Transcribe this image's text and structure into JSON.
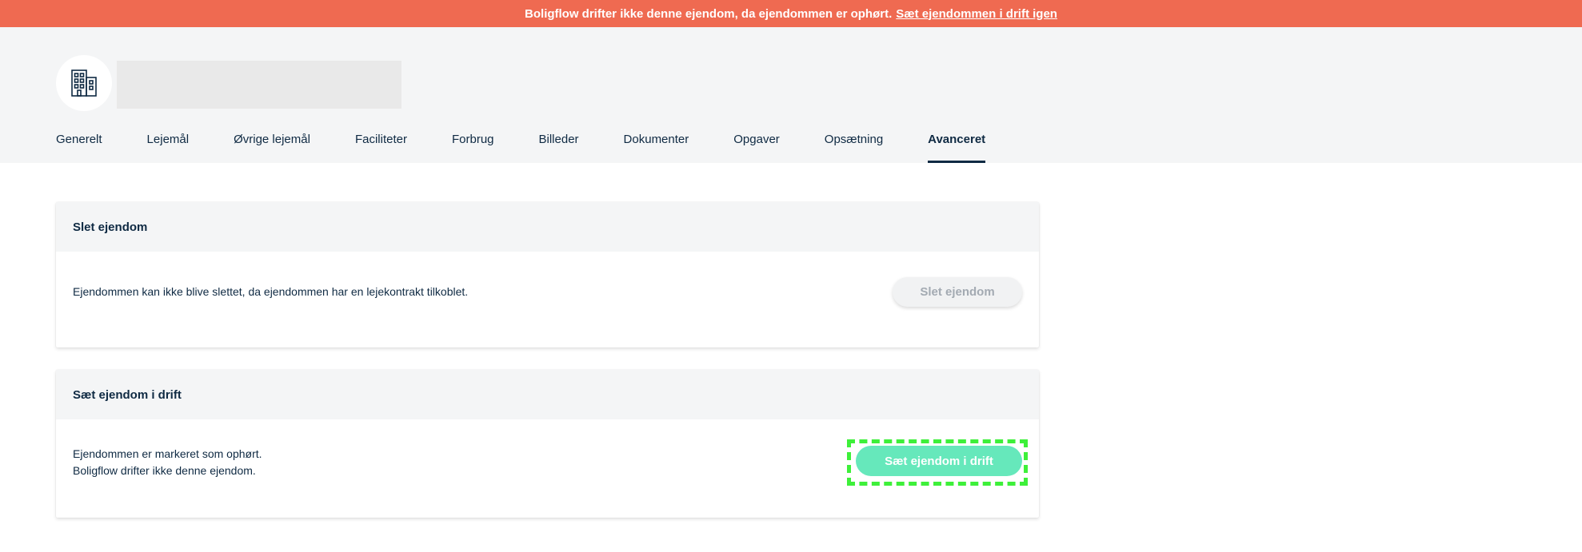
{
  "banner": {
    "message": "Boligflow drifter ikke denne ejendom, da ejendommen er ophørt.",
    "link": "Sæt ejendommen i drift igen"
  },
  "tabs": [
    {
      "label": "Generelt"
    },
    {
      "label": "Lejemål"
    },
    {
      "label": "Øvrige lejemål"
    },
    {
      "label": "Faciliteter"
    },
    {
      "label": "Forbrug"
    },
    {
      "label": "Billeder"
    },
    {
      "label": "Dokumenter"
    },
    {
      "label": "Opgaver"
    },
    {
      "label": "Opsætning"
    },
    {
      "label": "Avanceret",
      "active": true
    }
  ],
  "delete_card": {
    "title": "Slet ejendom",
    "text": "Ejendommen kan ikke blive slettet, da ejendommen har en lejekontrakt tilkoblet.",
    "button": "Slet ejendom"
  },
  "activate_card": {
    "title": "Sæt ejendom i drift",
    "line1": "Ejendommen er markeret som ophørt.",
    "line2": "Boligflow drifter ikke denne ejendom.",
    "button": "Sæt ejendom i drift"
  },
  "icons": {
    "building": "building-icon"
  },
  "colors": {
    "banner": "#ef6a51",
    "primary_button": "#66e8bb",
    "text": "#0f2a43",
    "highlight": "#3ef03a"
  }
}
